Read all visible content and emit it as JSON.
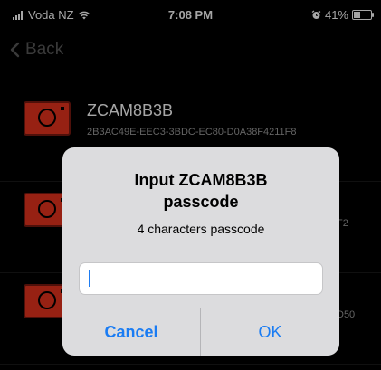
{
  "status_bar": {
    "carrier": "Voda NZ",
    "time": "7:08 PM",
    "battery_percent": "41%",
    "battery_level": 0.41
  },
  "nav": {
    "back_label": "Back"
  },
  "devices": [
    {
      "name": "ZCAM8B3B",
      "id": "2B3AC49E-EEC3-3BDC-EC80-D0A38F4211F8"
    },
    {
      "name": "",
      "id": "F2"
    },
    {
      "name": "",
      "id": "D50"
    }
  ],
  "alert": {
    "title_line1": "Input ZCAM8B3B",
    "title_line2": "passcode",
    "message": "4 characters passcode",
    "input_value": "",
    "cancel_label": "Cancel",
    "ok_label": "OK"
  },
  "colors": {
    "accent": "#1a7cf3",
    "camera_icon": "#e8341e",
    "alert_bg": "#dcdcde",
    "background": "#000000"
  },
  "icons": [
    "signal-icon",
    "wifi-icon",
    "alarm-icon",
    "battery-icon",
    "back-chevron-icon",
    "camera-icon"
  ]
}
